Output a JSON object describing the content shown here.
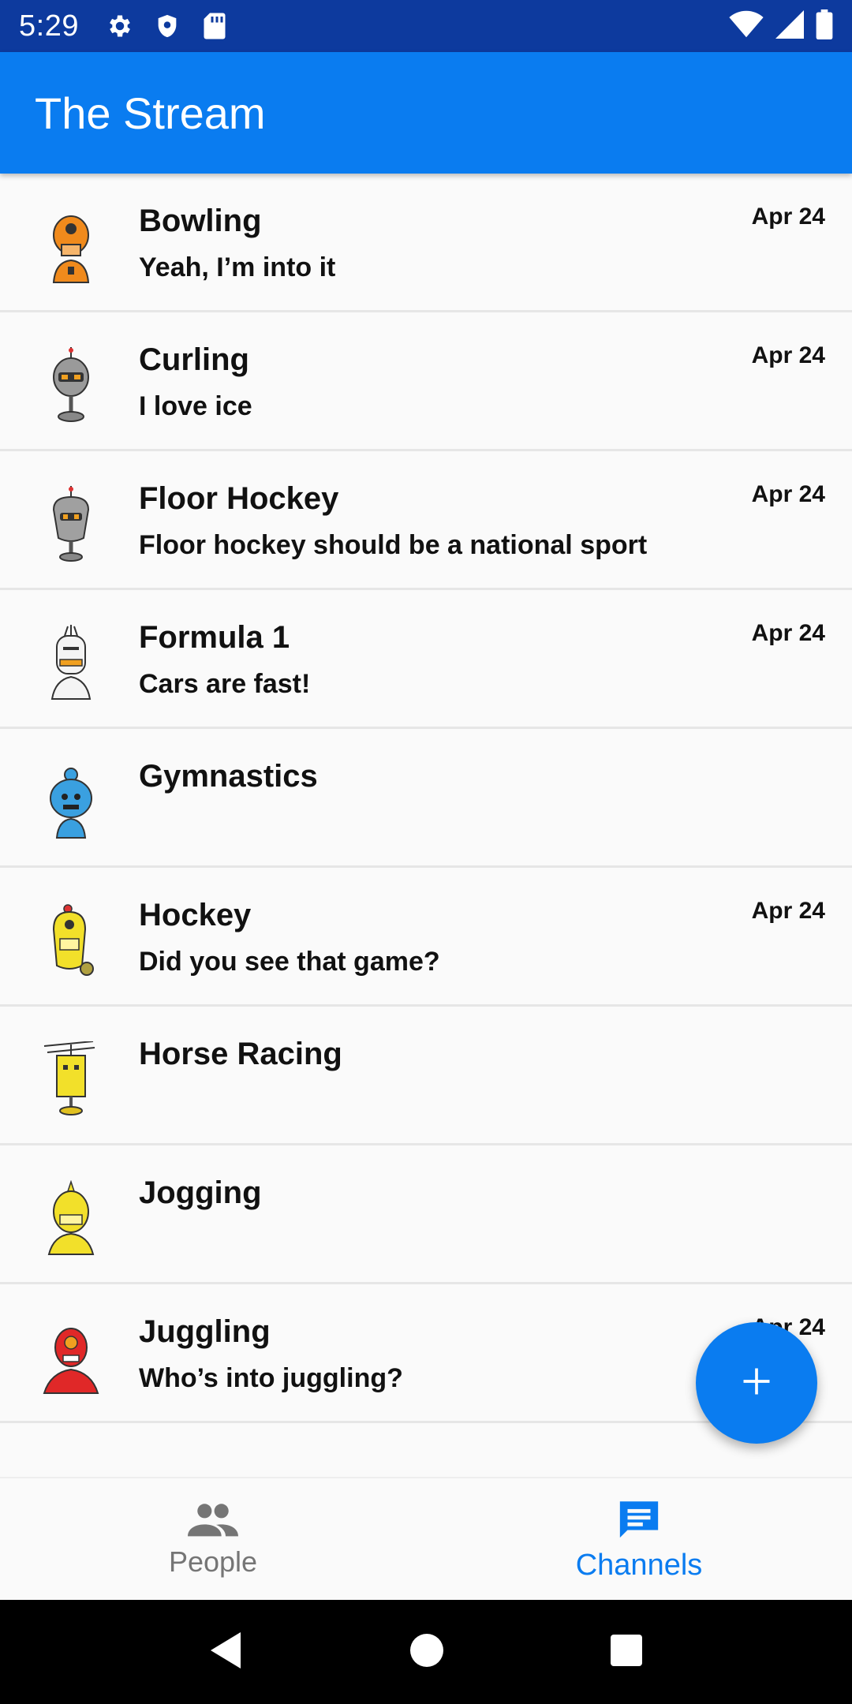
{
  "status_bar": {
    "time": "5:29",
    "icons_left": [
      "gear-icon",
      "shield-icon",
      "sd-card-icon"
    ],
    "icons_right": [
      "wifi-icon",
      "signal-icon",
      "battery-icon"
    ]
  },
  "app_bar": {
    "title": "The Stream",
    "color": "#0a7cf0"
  },
  "channels": [
    {
      "name": "Bowling",
      "message": "Yeah, I’m into it",
      "date": "Apr 24",
      "avatar": "orange-robot"
    },
    {
      "name": "Curling",
      "message": "I love ice",
      "date": "Apr 24",
      "avatar": "gray-robot"
    },
    {
      "name": "Floor Hockey",
      "message": "Floor hockey should be a national sport",
      "date": "Apr 24",
      "avatar": "gray-robot"
    },
    {
      "name": "Formula 1",
      "message": "Cars are fast!",
      "date": "Apr 24",
      "avatar": "white-robot"
    },
    {
      "name": "Gymnastics",
      "message": "",
      "date": "",
      "avatar": "blue-robot"
    },
    {
      "name": "Hockey",
      "message": "Did you see that game?",
      "date": "Apr 24",
      "avatar": "yellow-robot"
    },
    {
      "name": "Horse Racing",
      "message": "",
      "date": "",
      "avatar": "yellow-antenna-robot"
    },
    {
      "name": "Jogging",
      "message": "",
      "date": "",
      "avatar": "yellow-robot"
    },
    {
      "name": "Juggling",
      "message": "Who’s into juggling?",
      "date": "Apr 24",
      "avatar": "red-robot"
    }
  ],
  "fab": {
    "icon": "plus-icon"
  },
  "bottom_nav": {
    "people_label": "People",
    "channels_label": "Channels",
    "active": "Channels"
  },
  "system_nav": [
    "back-icon",
    "home-icon",
    "recents-icon"
  ]
}
